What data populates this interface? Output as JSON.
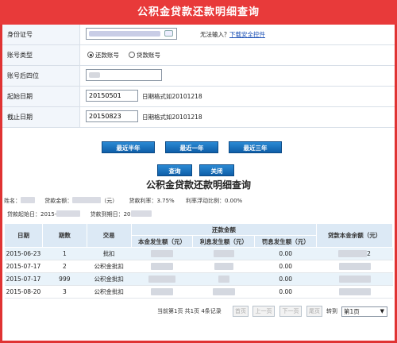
{
  "header": {
    "title": "公积金贷款还款明细查询"
  },
  "form": {
    "id_label": "身份证号",
    "no_input_hint": "无法输入？",
    "download_link": "下载安全控件",
    "account_type_label": "账号类型",
    "radio_repay": "还款账号",
    "radio_loan": "贷款账号",
    "last4_label": "账号后四位",
    "start_label": "起始日期",
    "start_value": "20150501",
    "start_hint": "日期格式如20101218",
    "end_label": "截止日期",
    "end_value": "20150823",
    "end_hint": "日期格式如20101218"
  },
  "buttons": {
    "half_year": "最近半年",
    "one_year": "最近一年",
    "three_year": "最近三年",
    "query": "查询",
    "close": "关闭"
  },
  "result": {
    "title": "公积金贷款还款明细查询",
    "name_label": "姓名：",
    "amount_label": "贷款金额：",
    "amount_unit": "（元）",
    "rate_label": "贷款利率：",
    "rate_value": "3.75%",
    "float_label": "利率浮动比例：",
    "float_value": "0.00%",
    "start_label": "贷款起始日：",
    "start_value": "2015-",
    "due_label": "贷款到期日：",
    "due_value": "20"
  },
  "table": {
    "headers": {
      "date": "日期",
      "period": "期数",
      "trade": "交易",
      "repay_group": "还款金额",
      "principal": "本金发生额（元）",
      "interest": "利息发生额（元）",
      "penalty": "罚息发生额（元）",
      "balance": "贷款本金余额（元）"
    },
    "rows": [
      {
        "date": "2015-06-23",
        "period": "1",
        "trade": "批扣",
        "penalty": "0.00",
        "bal_tail": "2"
      },
      {
        "date": "2015-07-17",
        "period": "2",
        "trade": "公积金批扣",
        "penalty": "0.00",
        "bal_tail": ""
      },
      {
        "date": "2015-07-17",
        "period": "999",
        "trade": "公积金批扣",
        "penalty": "0.00",
        "bal_tail": ""
      },
      {
        "date": "2015-08-20",
        "period": "3",
        "trade": "公积金批扣",
        "penalty": "0.00",
        "bal_tail": ""
      }
    ]
  },
  "pager": {
    "summary": "当前第1页 共1页 4条记录",
    "first": "首页",
    "prev": "上一页",
    "next": "下一页",
    "last": "尾页",
    "goto": "转到",
    "select_value": "第1页"
  }
}
